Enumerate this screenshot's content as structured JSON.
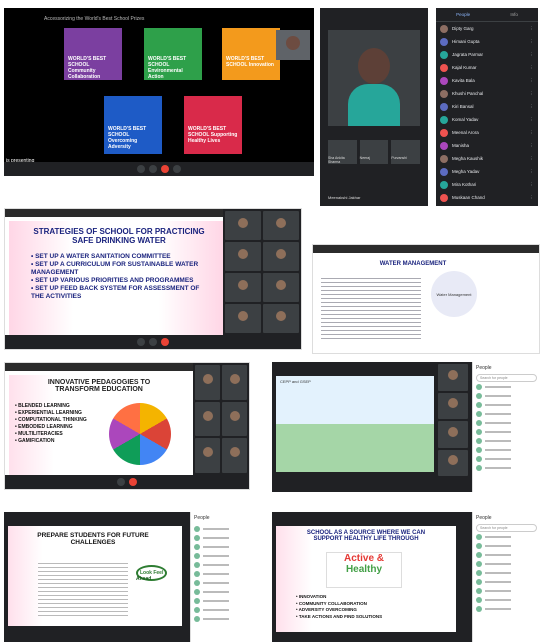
{
  "tile1": {
    "title": "Accessorizing the World's Best School Prizes",
    "presenting": "is presenting",
    "cards": [
      {
        "label": "WORLD'S BEST SCHOOL Community Collaboration",
        "color": "#7b3fa0"
      },
      {
        "label": "WORLD'S BEST SCHOOL Environmental Action",
        "color": "#2ea04a"
      },
      {
        "label": "WORLD'S BEST SCHOOL Innovation",
        "color": "#f39a1c"
      },
      {
        "label": "WORLD'S BEST SCHOOL Overcoming Adversity",
        "color": "#1e5bc6"
      },
      {
        "label": "WORLD'S BEST SCHOOL Supporting Healthy Lives",
        "color": "#d92a4a"
      }
    ]
  },
  "tile2": {
    "bottom_names": [
      "Sha Ankita Sharma",
      "Neeraj",
      "Purvanshi"
    ],
    "footer": "Meenakshi Jakhar"
  },
  "tile3": {
    "tab1": "People",
    "tab2": "Info",
    "people": [
      "Dipty Garg",
      "Himani Gupta",
      "Jagrata Parmar",
      "Kajal Kumar",
      "Kavita Bala",
      "Khushi Panchal",
      "Kiri Bansal",
      "Komal Yadav",
      "Meenal Arora",
      "Manisha",
      "Megha Kaushik",
      "Megha Yadav",
      "Mira Kothari",
      "Muskaan Chand"
    ]
  },
  "tile4": {
    "title": "STRATEGIES OF SCHOOL FOR PRACTICING SAFE DRINKING WATER",
    "bullets": [
      "• SET UP A WATER SANITATION COMMITTEE",
      "• SET UP A CURRICULUM FOR SUSTAINABLE WATER MANAGEMENT",
      "• SET UP VARIOUS PRIORITIES AND PROGRAMMES",
      "• SET UP FEED BACK SYSTEM FOR ASSESSMENT OF THE ACTIVITIES"
    ]
  },
  "tile5": {
    "title": "WATER MANAGEMENT",
    "center": "Water Management"
  },
  "tile6": {
    "title": "INNOVATIVE PEDAGOGIES TO TRANSFORM EDUCATION",
    "bullets": [
      "• BLENDED LEARNING",
      "• EXPERIENTIAL LEARNING",
      "• COMPUTATIONAL THINKING",
      "• EMBODIED LEARNING",
      "• MULTILITERACIES",
      "• GAMIFICATION"
    ]
  },
  "tile7": {
    "caption": "CEPP and GSEP",
    "panel_title": "People",
    "search": "Search for people"
  },
  "tile8": {
    "title": "PREPARE STUDENTS FOR FUTURE CHALLENGES",
    "logo_left": "Look Feel",
    "logo_right": "Ahead",
    "panel_title": "People"
  },
  "tile9": {
    "title": "SCHOOL AS A SOURCE WHERE WE CAN SUPPORT HEALTHY LIFE THROUGH",
    "logo_line1": "Active &",
    "logo_line2": "Healthy",
    "bullets": [
      "• INNOVATION",
      "• COMMUNITY COLLABORATION",
      "• ADVERSITY OVERCOMING",
      "• TAKE ACTIONS AND FIND SOLUTIONS"
    ],
    "panel_title": "People",
    "search": "Search for people"
  }
}
